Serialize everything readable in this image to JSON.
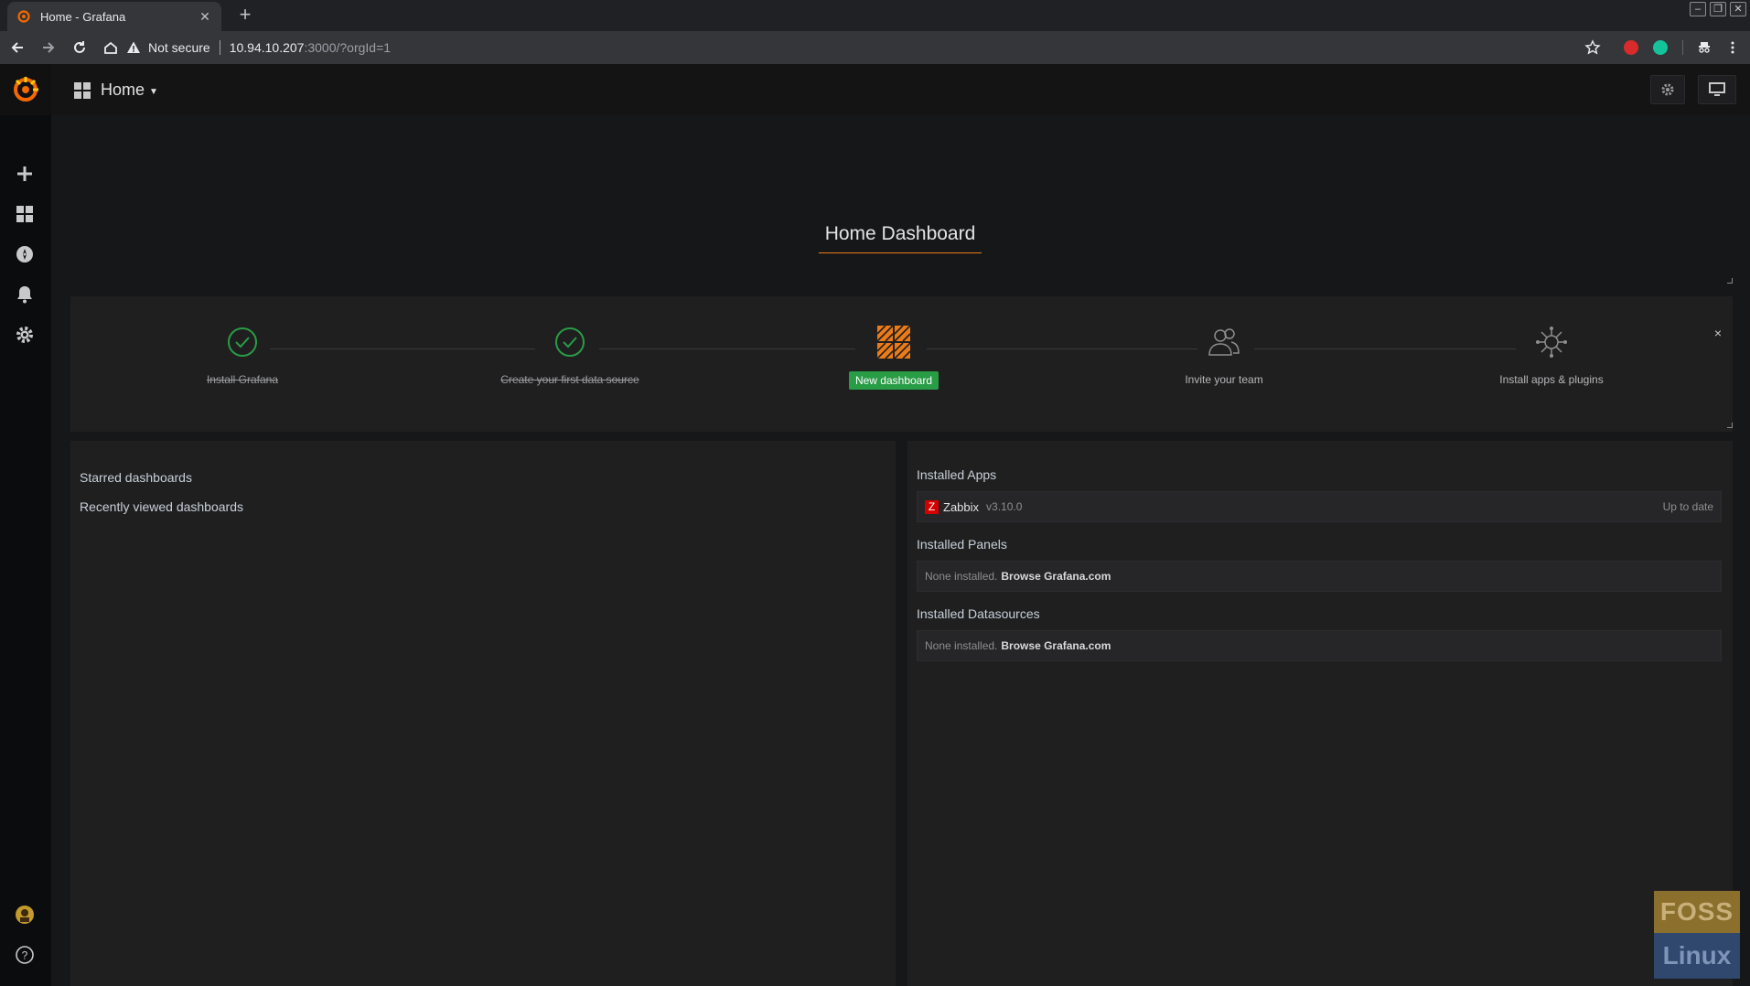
{
  "browser": {
    "tab_title": "Home - Grafana",
    "not_secure": "Not secure",
    "url_host": "10.94.10.207",
    "url_rest": ":3000/?orgId=1"
  },
  "navbar": {
    "dashboard_title": "Home"
  },
  "home": {
    "title": "Home Dashboard"
  },
  "getting_started": {
    "steps": [
      {
        "label": "Install Grafana",
        "state": "done",
        "icon": "check-circle-icon"
      },
      {
        "label": "Create your first data source",
        "state": "done",
        "icon": "check-circle-icon"
      },
      {
        "label": "New dashboard",
        "state": "active",
        "icon": "dashboard-grid-icon"
      },
      {
        "label": "Invite your team",
        "state": "todo",
        "icon": "users-icon"
      },
      {
        "label": "Install apps & plugins",
        "state": "todo",
        "icon": "plugins-icon"
      }
    ],
    "close": "×"
  },
  "left_panel": {
    "starred": "Starred dashboards",
    "recent": "Recently viewed dashboards"
  },
  "right_panel": {
    "apps_title": "Installed Apps",
    "app": {
      "badge": "Z",
      "name": "Zabbix",
      "version": "v3.10.0",
      "status": "Up to date"
    },
    "panels_title": "Installed Panels",
    "panels_none": "None installed.",
    "panels_link": "Browse Grafana.com",
    "datasources_title": "Installed Datasources",
    "datasources_none": "None installed.",
    "datasources_link": "Browse Grafana.com"
  },
  "watermark": {
    "top": "FOSS",
    "bottom": "Linux"
  },
  "colors": {
    "accent": "#eb7b18",
    "success": "#299c46",
    "panel": "#1f1f20"
  }
}
